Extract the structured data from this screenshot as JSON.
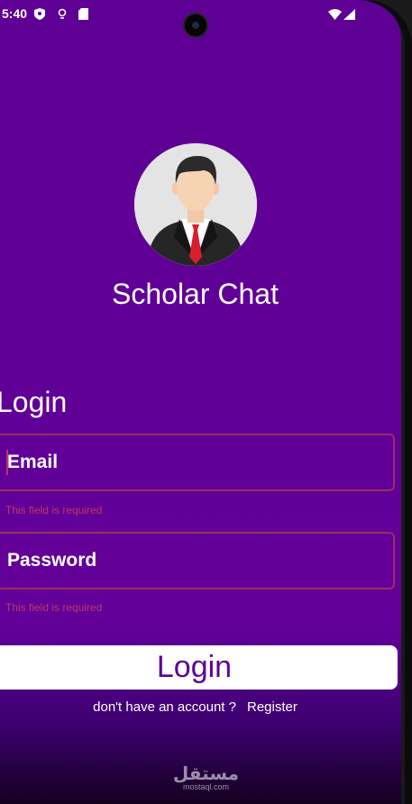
{
  "status_bar": {
    "time": "5:40"
  },
  "app": {
    "title": "Scholar Chat"
  },
  "form": {
    "heading": "Login",
    "email": {
      "placeholder": "Email",
      "error": "This field is required"
    },
    "password": {
      "placeholder": "Password",
      "error": "This field is required"
    },
    "submit_label": "Login"
  },
  "register": {
    "prompt": "don't have an account ?",
    "link_label": "Register"
  },
  "watermark": {
    "arabic": "مستقل",
    "latin": "mostaql.com"
  },
  "colors": {
    "background": "#5e0094",
    "error": "#b83a67",
    "button": "#ffffff"
  }
}
